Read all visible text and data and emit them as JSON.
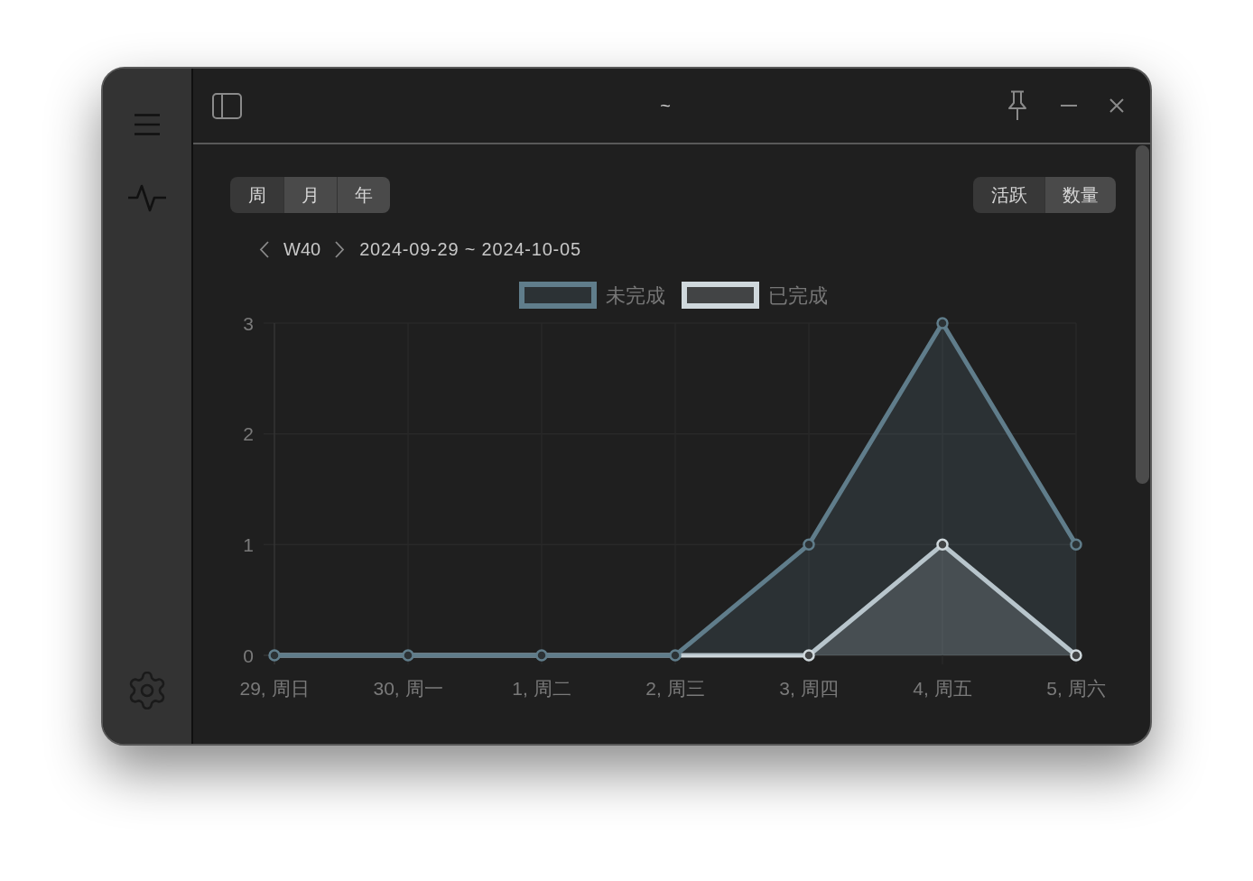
{
  "window": {
    "title": "~"
  },
  "period_tabs": [
    {
      "label": "周",
      "selected": true
    },
    {
      "label": "月",
      "selected": false
    },
    {
      "label": "年",
      "selected": false
    }
  ],
  "mode_tabs": [
    {
      "label": "活跃",
      "selected": true
    },
    {
      "label": "数量",
      "selected": false
    }
  ],
  "week_nav": {
    "week": "W40",
    "range": "2024-09-29 ~ 2024-10-05"
  },
  "chart": {
    "chart_data": [
      {
        "type": "area",
        "categories": [
          "29, 周日",
          "30, 周一",
          "1, 周二",
          "2, 周三",
          "3, 周四",
          "4, 周五",
          "5, 周六"
        ],
        "series": [
          {
            "name": "未完成",
            "color": "#607d8b",
            "values": [
              0,
              0,
              0,
              0,
              1,
              3,
              1
            ]
          },
          {
            "name": "已完成",
            "color": "#cfd8dc",
            "values": [
              0,
              0,
              0,
              0,
              0,
              1,
              0
            ]
          }
        ],
        "ylim": [
          0,
          3
        ],
        "yticks": [
          0,
          1,
          2,
          3
        ],
        "legend": "top",
        "grid": true
      }
    ]
  }
}
